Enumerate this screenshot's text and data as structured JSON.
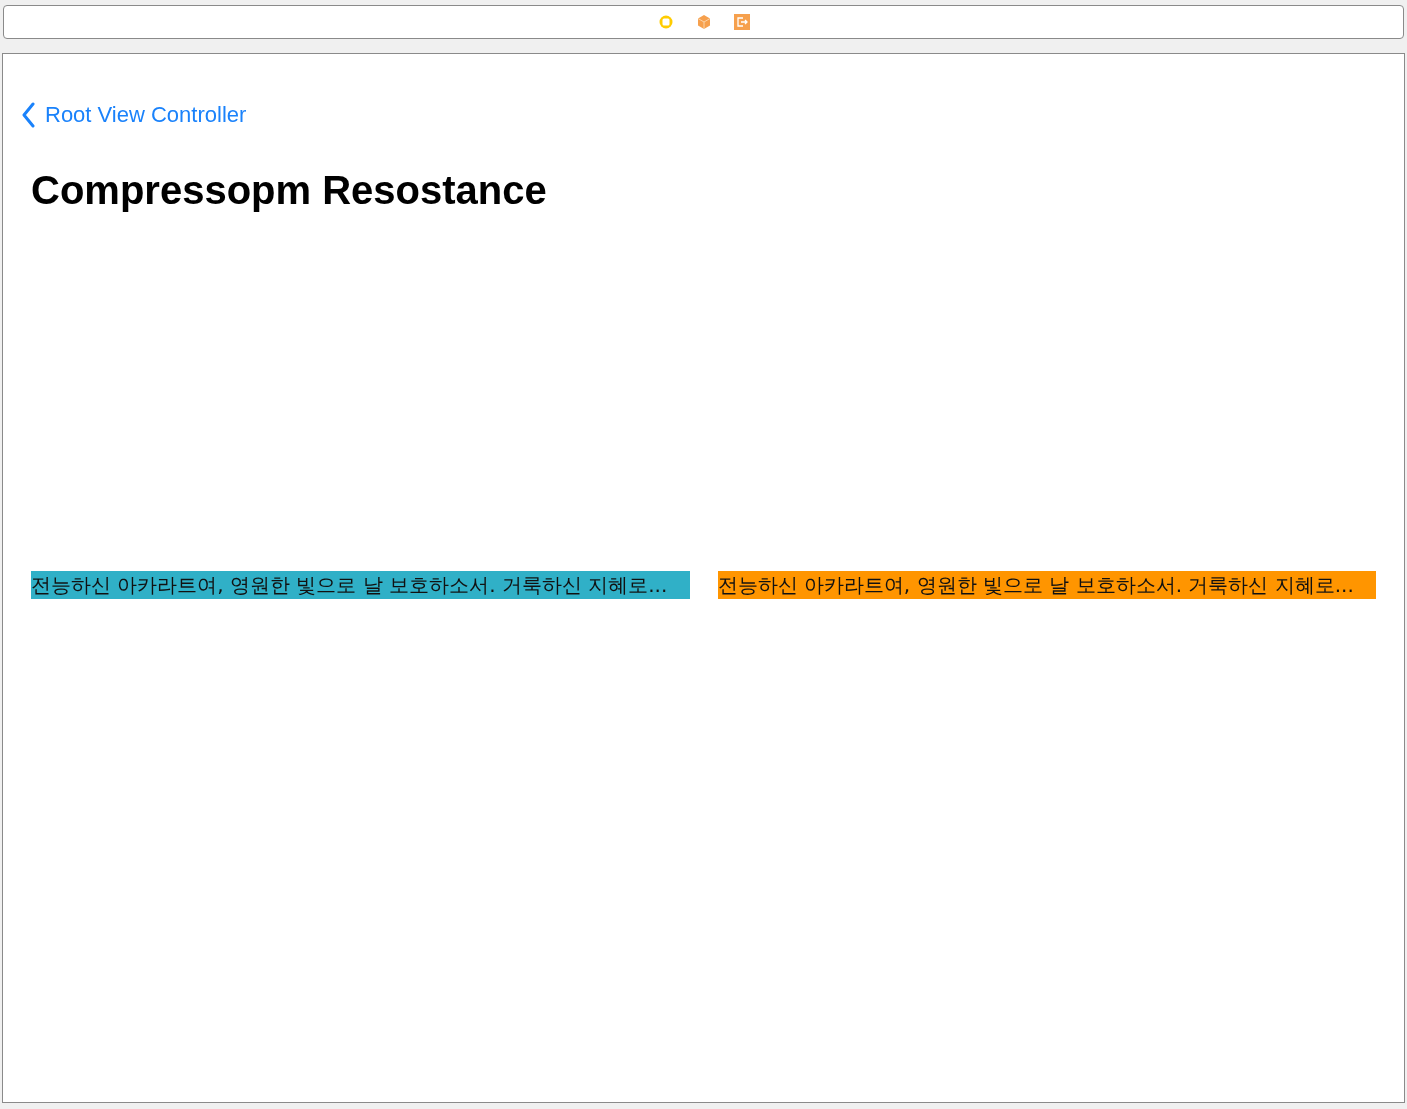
{
  "nav": {
    "back_label": "Root View Controller",
    "title": "Compressopm Resostance"
  },
  "labels": [
    {
      "text": "전능하신 아카라트여, 영원한 빛으로 날 보호하소서. 거룩하신 지혜로...",
      "color": "#30b0c7"
    },
    {
      "text": "전능하신 아카라트여, 영원한 빛으로 날 보호하소서. 거룩하신 지혜로...",
      "color": "#ff9500"
    }
  ]
}
